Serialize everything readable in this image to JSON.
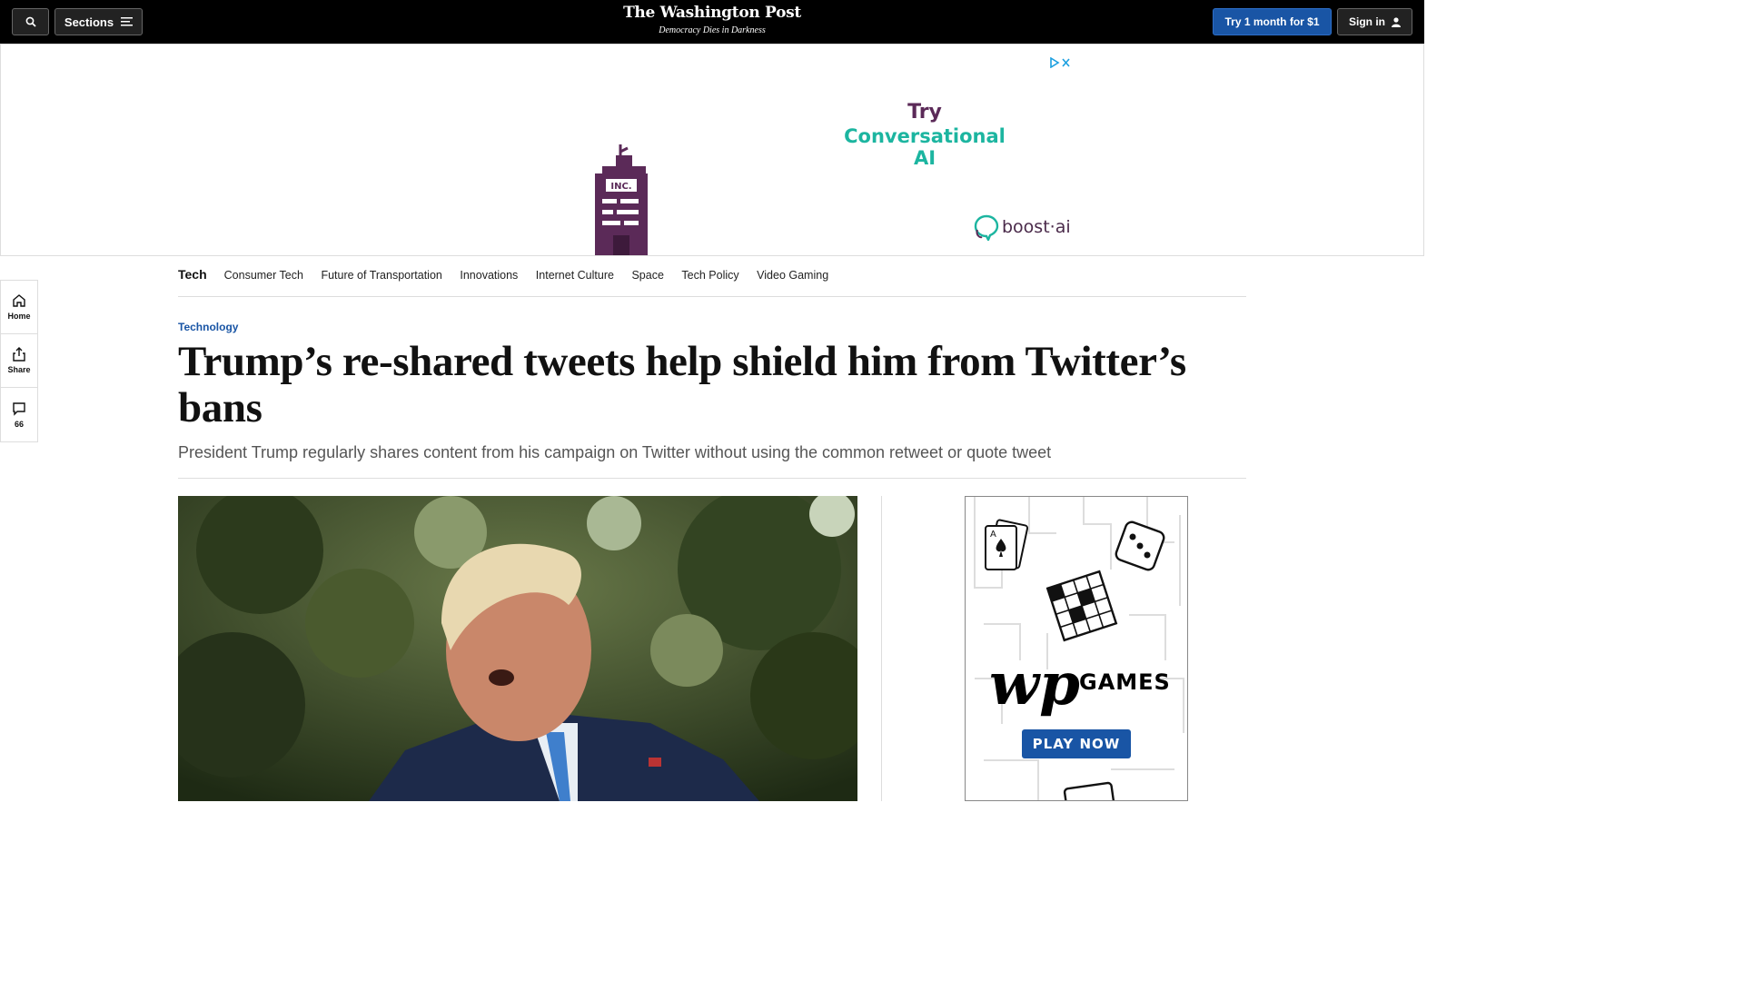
{
  "header": {
    "sections_label": "Sections",
    "logo_name": "The Washington Post",
    "logo_tagline": "Democracy Dies in Darkness",
    "try_label": "Try 1 month for $1",
    "signin_label": "Sign in"
  },
  "ad_banner": {
    "line1": "Try",
    "line2": "Conversational AI",
    "building_label": "INC.",
    "brand": "boost·ai"
  },
  "rail": {
    "home_label": "Home",
    "share_label": "Share",
    "comments_count": "66"
  },
  "subnav": {
    "section": "Tech",
    "links": [
      "Consumer Tech",
      "Future of Transportation",
      "Innovations",
      "Internet Culture",
      "Space",
      "Tech Policy",
      "Video Gaming"
    ]
  },
  "article": {
    "kicker": "Technology",
    "headline": "Trump’s re-shared tweets help shield him from Twitter’s bans",
    "dek": "President Trump regularly shares content from his campaign on Twitter without using the common retweet or quote tweet"
  },
  "games_ad": {
    "games_label": "GAMES",
    "play_label": "PLAY NOW"
  },
  "colors": {
    "brand_blue": "#1955a5",
    "ad_purple": "#5b2a58",
    "ad_teal": "#1cb5a0"
  }
}
